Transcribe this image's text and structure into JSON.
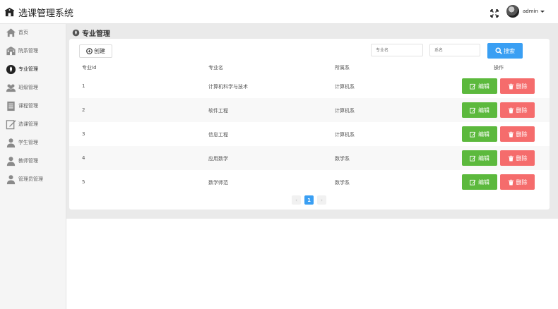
{
  "header": {
    "app_title": "选课管理系统",
    "username": "admin"
  },
  "sidebar": {
    "items": [
      {
        "label": "首页",
        "icon": "home-icon"
      },
      {
        "label": "院系管理",
        "icon": "school-icon"
      },
      {
        "label": "专业管理",
        "icon": "major-icon"
      },
      {
        "label": "班级管理",
        "icon": "class-icon"
      },
      {
        "label": "课程管理",
        "icon": "course-icon"
      },
      {
        "label": "选课管理",
        "icon": "enroll-icon"
      },
      {
        "label": "学生管理",
        "icon": "student-icon"
      },
      {
        "label": "教师管理",
        "icon": "teacher-icon"
      },
      {
        "label": "管理员管理",
        "icon": "admin-icon"
      }
    ],
    "active_index": 2
  },
  "main": {
    "page_title": "专业管理",
    "create_label": "创建",
    "search": {
      "major_placeholder": "专业名",
      "dept_placeholder": "系名",
      "button_label": "搜索"
    },
    "table": {
      "headers": {
        "id": "专业Id",
        "name": "专业名",
        "dept": "所属系",
        "ops": "操作"
      },
      "edit_label": "编辑",
      "delete_label": "删除",
      "rows": [
        {
          "id": "1",
          "name": "计算机科学与技术",
          "dept": "计算机系"
        },
        {
          "id": "2",
          "name": "软件工程",
          "dept": "计算机系"
        },
        {
          "id": "3",
          "name": "信息工程",
          "dept": "计算机系"
        },
        {
          "id": "4",
          "name": "应用数学",
          "dept": "数学系"
        },
        {
          "id": "5",
          "name": "数学师范",
          "dept": "数学系"
        }
      ]
    },
    "pagination": {
      "prev": "‹",
      "current": "1",
      "next": "›"
    }
  },
  "colors": {
    "primary": "#3a9ff3",
    "edit": "#5cb93d",
    "delete": "#f56c6c"
  }
}
